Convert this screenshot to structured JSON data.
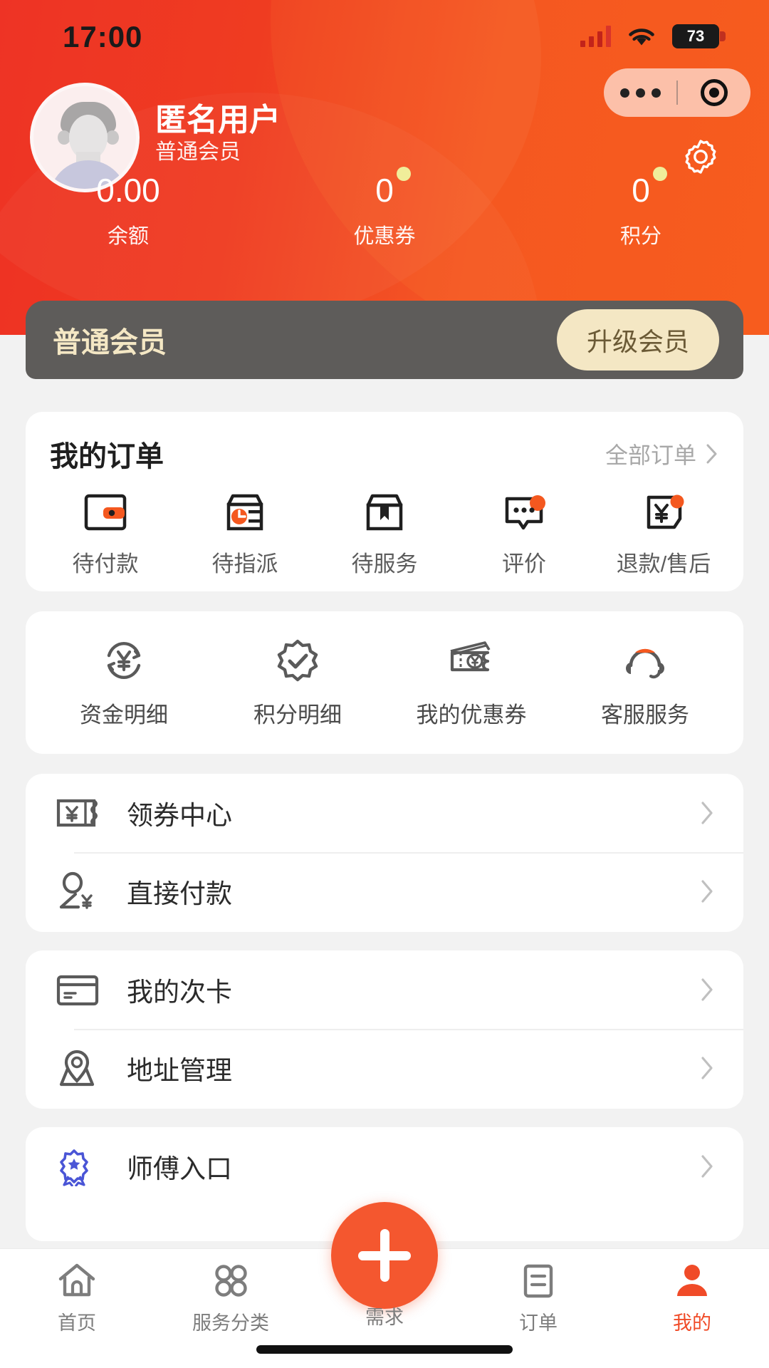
{
  "status_bar": {
    "time": "17:00",
    "battery_level": "73",
    "signal_icon": "signal-bars-icon",
    "wifi_icon": "wifi-icon",
    "battery_icon": "battery-icon"
  },
  "capsule": {
    "more_icon": "more-dots-icon",
    "target_icon": "target-circle-icon"
  },
  "header": {
    "settings_icon": "gear-icon",
    "avatar_icon": "user-avatar-placeholder",
    "username": "匿名用户",
    "member_level": "普通会员",
    "stats": [
      {
        "value": "0.00",
        "label": "余额",
        "has_dot": false
      },
      {
        "value": "0",
        "label": "优惠券",
        "has_dot": true
      },
      {
        "value": "0",
        "label": "积分",
        "has_dot": true
      }
    ]
  },
  "vip_card": {
    "title": "普通会员",
    "button_label": "升级会员",
    "bg_color": "#5e5c5a",
    "accent_color": "#f4e7c4"
  },
  "orders": {
    "title": "我的订单",
    "all_orders_label": "全部订单",
    "chevron_icon": "chevron-right-icon",
    "items": [
      {
        "label": "待付款",
        "icon": "wallet-icon"
      },
      {
        "label": "待指派",
        "icon": "assign-box-icon"
      },
      {
        "label": "待服务",
        "icon": "package-bookmark-icon"
      },
      {
        "label": "评价",
        "icon": "comment-bubble-icon"
      },
      {
        "label": "退款/售后",
        "icon": "refund-yuan-icon"
      }
    ]
  },
  "services": {
    "items": [
      {
        "label": "资金明细",
        "icon": "yuan-refresh-icon"
      },
      {
        "label": "积分明细",
        "icon": "badge-check-icon"
      },
      {
        "label": "我的优惠券",
        "icon": "coupon-ticket-icon"
      },
      {
        "label": "客服服务",
        "icon": "headset-support-icon"
      }
    ]
  },
  "menu_group_1": [
    {
      "label": "领券中心",
      "icon": "coupon-yuan-icon",
      "chevron": "chevron-right-icon"
    },
    {
      "label": "直接付款",
      "icon": "person-yuan-icon",
      "chevron": "chevron-right-icon"
    }
  ],
  "menu_group_2": [
    {
      "label": "我的次卡",
      "icon": "card-icon",
      "chevron": "chevron-right-icon"
    },
    {
      "label": "地址管理",
      "icon": "location-pin-icon",
      "chevron": "chevron-right-icon"
    }
  ],
  "menu_group_3": [
    {
      "label": "师傅入口",
      "icon": "master-badge-icon",
      "chevron": "chevron-right-icon"
    }
  ],
  "tabbar": {
    "accent_color": "#f04b28",
    "items": [
      {
        "label": "首页",
        "icon": "home-icon",
        "active": false
      },
      {
        "label": "服务分类",
        "icon": "grid-icon",
        "active": false
      },
      {
        "label": "需求",
        "icon": "plus-icon",
        "active": false
      },
      {
        "label": "订单",
        "icon": "order-list-icon",
        "active": false
      },
      {
        "label": "我的",
        "icon": "person-icon",
        "active": true
      }
    ]
  }
}
